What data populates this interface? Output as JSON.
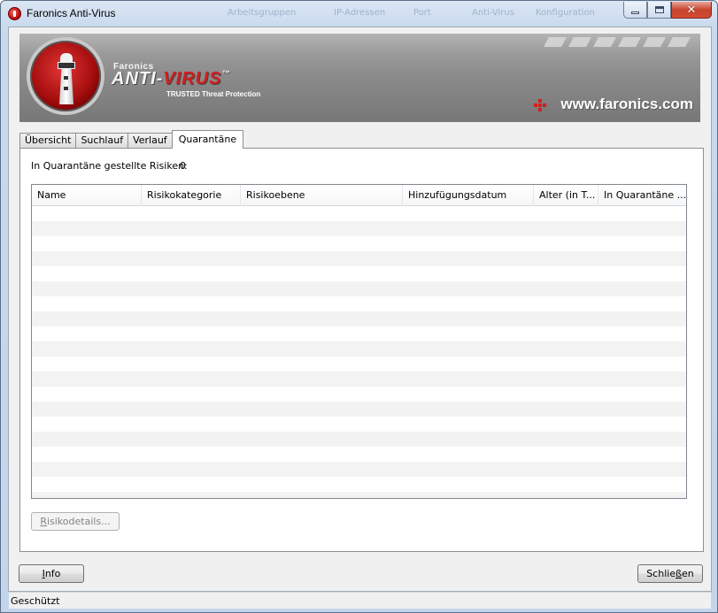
{
  "window": {
    "title": "Faronics Anti-Virus",
    "ghost_menu": [
      "Arbeitsgruppen",
      "IP-Adressen",
      "Port",
      "Anti-Virus",
      "Konfiguration"
    ]
  },
  "banner": {
    "brand_small": "Faronics",
    "brand_big_1": "ANTI-",
    "brand_big_2": "VIRUS",
    "brand_tm": "™",
    "tagline": "TRUSTED Threat Protection",
    "url": "www.faronics.com"
  },
  "tabs": [
    {
      "label": "Übersicht",
      "active": false
    },
    {
      "label": "Suchlauf",
      "active": false
    },
    {
      "label": "Verlauf",
      "active": false
    },
    {
      "label": "Quarantäne",
      "active": true
    }
  ],
  "quarantine": {
    "count_label": "In Quarantäne gestellte Risiken:",
    "count_value": "0",
    "columns": [
      "Name",
      "Risikokategorie",
      "Risikoebene",
      "Hinzufügungsdatum",
      "Alter (in T...",
      "In Quarantäne ..."
    ],
    "details_button_access_key": "R",
    "details_button_rest": "isikodetails..."
  },
  "footer": {
    "info_access_key": "I",
    "info_rest": "nfo",
    "close_prefix": "Schlie",
    "close_access_key": "ß",
    "close_rest": "en"
  },
  "status": {
    "text": "Geschützt"
  },
  "colors": {
    "accent_red": "#d51d1d",
    "close_button": "#c7442f",
    "banner_grey": "#8c8c8c"
  }
}
